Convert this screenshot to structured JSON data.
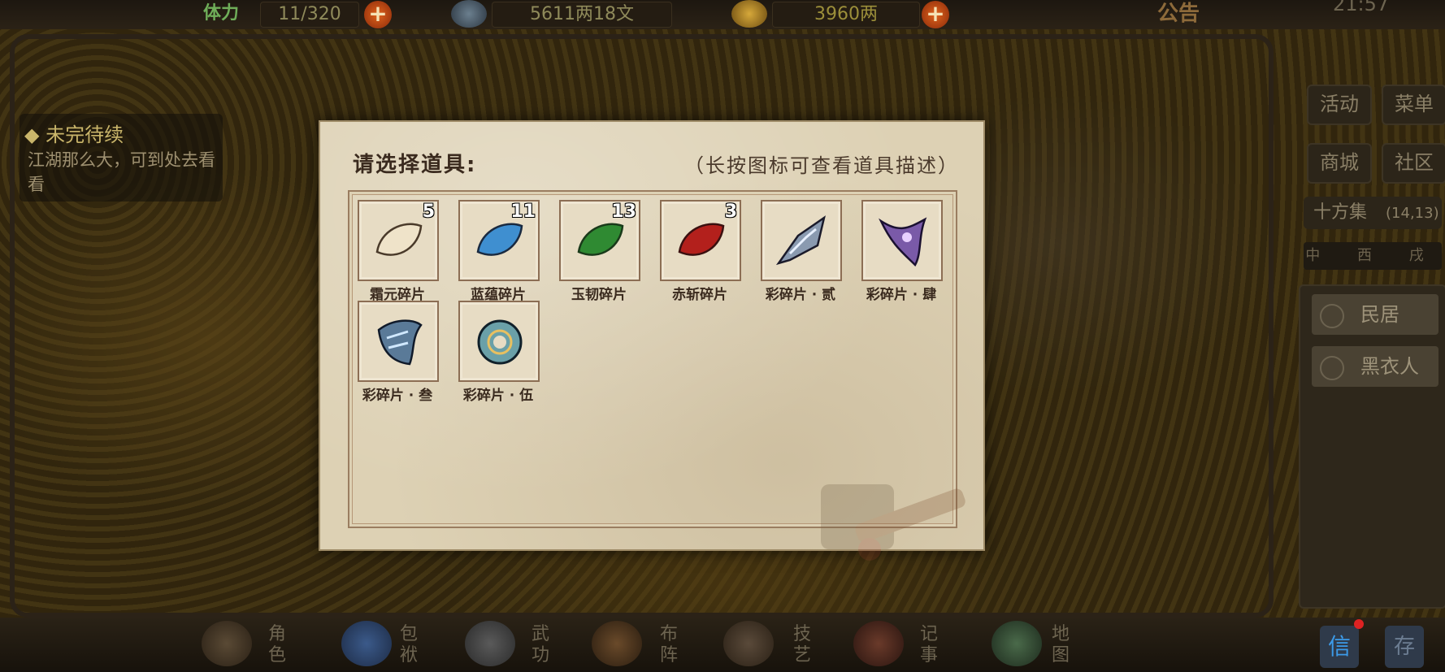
{
  "topbar": {
    "stamina_label": "体力",
    "stamina_value": "11/320",
    "money_value": "5611两18文",
    "gold_value": "3960两",
    "notice_label": "公告",
    "clock": "21:57",
    "plus_label": "+"
  },
  "quest": {
    "title": "◆ 未完待续",
    "text": "江湖那么大，可到处去看看"
  },
  "right_menu": {
    "activity": "活动",
    "menu": "菜单",
    "mall": "商城",
    "community": "社区",
    "location_name": "十方集",
    "location_coords": "(14,13)",
    "compass": "中 西 戌"
  },
  "npcs": [
    {
      "label": "民居"
    },
    {
      "label": "黑衣人"
    }
  ],
  "bottom_nav": [
    {
      "label": "角色"
    },
    {
      "label": "包袱"
    },
    {
      "label": "武功"
    },
    {
      "label": "布阵"
    },
    {
      "label": "技艺"
    },
    {
      "label": "记事"
    },
    {
      "label": "地图"
    }
  ],
  "bottom_right": {
    "mail": "信",
    "store": "存"
  },
  "dialog": {
    "title": "请选择道具:",
    "hint": "（长按图标可查看道具描述）",
    "items": [
      {
        "name": "霜元碎片",
        "count": "5",
        "icon": "white-shard-icon",
        "color": "#efe3c9"
      },
      {
        "name": "蓝蕴碎片",
        "count": "11",
        "icon": "blue-shard-icon",
        "color": "#3f8fd0"
      },
      {
        "name": "玉韧碎片",
        "count": "13",
        "icon": "green-shard-icon",
        "color": "#2f8a32"
      },
      {
        "name": "赤斩碎片",
        "count": "3",
        "icon": "red-shard-icon",
        "color": "#b3201c"
      },
      {
        "name": "彩碎片 · 贰",
        "count": "",
        "icon": "rainbow-blade-fragment-icon",
        "color": "#7a8aa0"
      },
      {
        "name": "彩碎片 · 肆",
        "count": "",
        "icon": "rainbow-hook-fragment-icon",
        "color": "#7a5aa8"
      },
      {
        "name": "彩碎片 · 叁",
        "count": "",
        "icon": "rainbow-claw-fragment-icon",
        "color": "#5a7a98"
      },
      {
        "name": "彩碎片 · 伍",
        "count": "",
        "icon": "rainbow-ring-fragment-icon",
        "color": "#6aa0a8"
      }
    ]
  }
}
